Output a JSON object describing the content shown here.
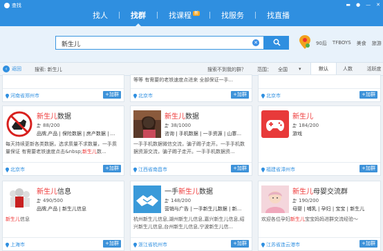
{
  "app": {
    "title": "查找"
  },
  "nav": {
    "tabs": [
      {
        "label": "找人"
      },
      {
        "label": "找群"
      },
      {
        "label": "找课程",
        "badge": "新"
      },
      {
        "label": "找服务"
      },
      {
        "label": "找直播"
      }
    ]
  },
  "search": {
    "value": "新生儿",
    "quick_tags": [
      "90后",
      "TFBOYS",
      "美食",
      "旅游"
    ]
  },
  "filter": {
    "back_label": "返回",
    "search_label": "搜索: 新生儿",
    "no_result_hint": "搜索不到我的群？",
    "scope_label": "范围：",
    "scope_value": "全国",
    "sort_tabs": [
      "默认",
      "人数",
      "活跃度"
    ]
  },
  "top_partial": [
    {
      "desc_tail": "",
      "location": "河南省郑州市",
      "join": "+加群"
    },
    {
      "desc_tail": "等等 有需要的老铁速度点进来 全部保证一手...",
      "location": "北京市",
      "join": "+加群"
    },
    {
      "desc_tail": "",
      "location": "北京市",
      "join": "+加群"
    }
  ],
  "groups": [
    {
      "name_hl": "新生儿",
      "name_rest": "数据",
      "count": "88/200",
      "tags": "品牌,产品 | 保险数据 | 房产数据 | ...",
      "desc_pre": "每天持续更新各类数据，选求质量不求数量，一手质量保证 有需要老铁速度点击&nbsp;",
      "desc_hl": "新生儿",
      "desc_post": "数...",
      "location": "北京市",
      "join": "+加群"
    },
    {
      "name_hl": "新生儿",
      "name_rest": "数据",
      "count": "38/1000",
      "tags": "咨询 | 手机数据 | 一手资源 | 山寨...",
      "desc_pre": "一手手机数据微信交流，骗子踢子走开。一手手机数据资源交流，骗子踢子走开。一手手机数据资...",
      "desc_hl": "",
      "desc_post": "",
      "location": "江西省南昌市",
      "join": "+加群"
    },
    {
      "name_hl": "新生儿",
      "name_rest": "",
      "count": "184/200",
      "tags": "游戏",
      "desc_pre": "",
      "desc_hl": "",
      "desc_post": "",
      "location": "福建省漳州市",
      "join": "+加群"
    },
    {
      "name_hl": "新生儿",
      "name_rest": "信息",
      "count": "490/500",
      "tags": "品牌,产品 | 新生儿信息",
      "desc_pre": "",
      "desc_hl": "新生儿",
      "desc_post": "信息",
      "location": "上海市",
      "join": "+加群"
    },
    {
      "name_pre": "一手",
      "name_hl": "新生儿",
      "name_rest": "数据",
      "count": "148/200",
      "tags": "营销与广告 | 一手新生儿数据 | 新...",
      "desc_pre": "杭州新生儿信息,湖州新生儿信息,嘉兴新生儿信息,绍兴新生儿信息,台州新生儿信息,宁波新生儿信...",
      "desc_hl": "",
      "desc_post": "",
      "location": "浙江省杭州市",
      "join": "+加群"
    },
    {
      "name_hl": "新生儿",
      "name_rest": "母婴交流群",
      "count": "190/200",
      "tags": "母婴 | 哺乳 | 孕妇 | 宝宝 | 新生儿",
      "desc_pre": "欢迎各位孕妇",
      "desc_hl": "新生儿",
      "desc_post": "宝宝妈妈进群交流经验～",
      "location": "江苏省连云港市",
      "join": "+加群"
    }
  ],
  "colors": {
    "topbar": "#2f8fe0",
    "highlight": "#e33333",
    "join_button": "#3d92d9"
  }
}
